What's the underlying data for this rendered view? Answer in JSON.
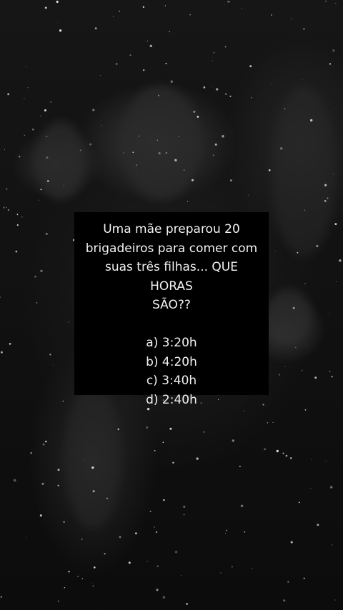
{
  "background": {
    "description_icon": "dark-snowy-battle-scene"
  },
  "quiz": {
    "question_lines": [
      "Uma mãe preparou 20",
      "brigadeiros para comer com",
      "suas três filhas... QUE HORAS",
      "SÃO??"
    ],
    "options": [
      "a) 3:20h",
      "b) 4:20h",
      "c) 3:40h",
      "d) 2:40h"
    ]
  },
  "colors": {
    "card_background": "#000000",
    "text": "#f2f2f2"
  }
}
